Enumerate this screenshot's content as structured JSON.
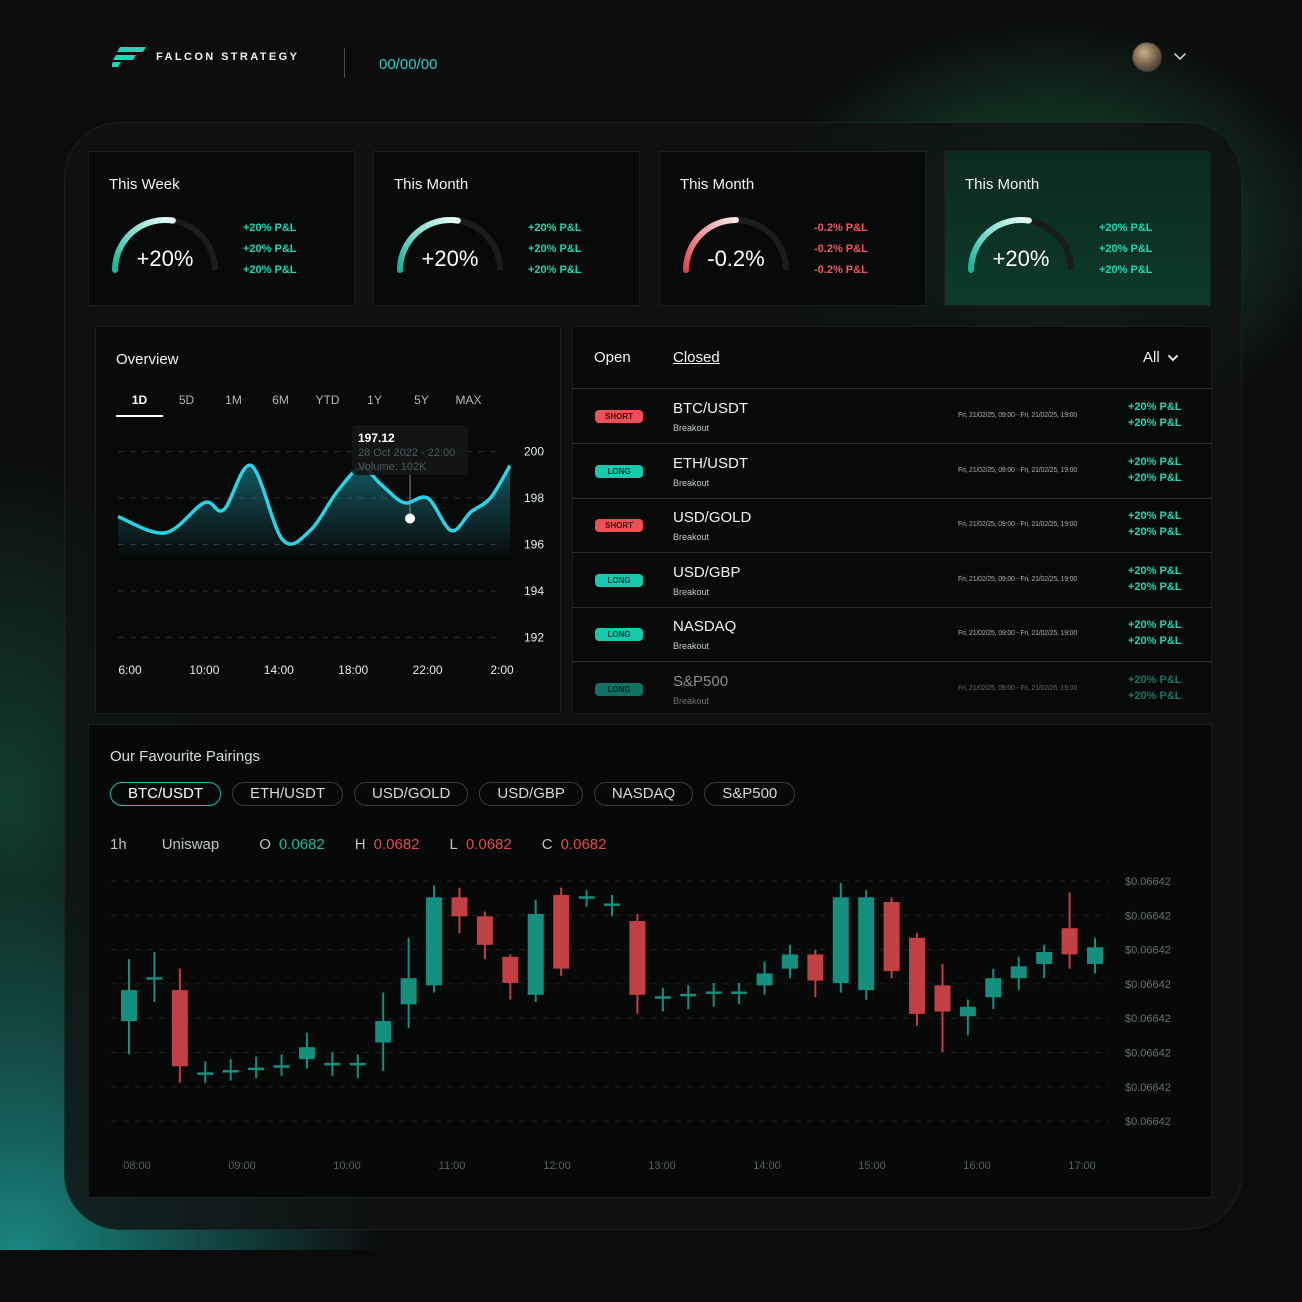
{
  "header": {
    "brand": "FALCON STRATEGY",
    "date": "00/00/00"
  },
  "colors": {
    "accent": "#1fd7b2",
    "negative": "#f0595c",
    "background": "#0c0c0d"
  },
  "stats": [
    {
      "title": "This Week",
      "value": "+20%",
      "gauge": 0.55,
      "tone": "positive",
      "pnl": [
        "+20% P&L",
        "+20% P&L",
        "+20% P&L"
      ]
    },
    {
      "title": "This Month",
      "value": "+20%",
      "gauge": 0.55,
      "tone": "positive",
      "pnl": [
        "+20% P&L",
        "+20% P&L",
        "+20% P&L"
      ]
    },
    {
      "title": "This Month",
      "value": "-0.2%",
      "gauge": 0.5,
      "tone": "negative",
      "pnl": [
        "-0.2% P&L",
        "-0.2% P&L",
        "-0.2% P&L"
      ]
    },
    {
      "title": "This Month",
      "value": "+20%",
      "gauge": 0.55,
      "tone": "positive",
      "pnl": [
        "+20% P&L",
        "+20% P&L",
        "+20% P&L"
      ]
    }
  ],
  "overview": {
    "title": "Overview",
    "ranges": [
      "1D",
      "5D",
      "1M",
      "6M",
      "YTD",
      "1Y",
      "5Y",
      "MAX"
    ],
    "active_range": "1D",
    "tooltip": {
      "value": "197.12",
      "date": "28 Oct 2022 - 22:00",
      "volume": "Volume: 102K"
    }
  },
  "trades": {
    "tabs": {
      "open": "Open",
      "closed": "Closed"
    },
    "filter": "All",
    "rows": [
      {
        "side": "SHORT",
        "pair": "BTC/USDT",
        "strategy": "Breakout",
        "dates": "Fri, 21/02/25, 09:00 - Fri, 21/02/25, 19:00",
        "pnl": [
          "+20% P&L",
          "+20% P&L"
        ]
      },
      {
        "side": "LONG",
        "pair": "ETH/USDT",
        "strategy": "Breakout",
        "dates": "Fri, 21/02/25, 09:00 - Fri, 21/02/25, 19:00",
        "pnl": [
          "+20% P&L",
          "+20% P&L"
        ]
      },
      {
        "side": "SHORT",
        "pair": "USD/GOLD",
        "strategy": "Breakout",
        "dates": "Fri, 21/02/25, 09:00 - Fri, 21/02/25, 19:00",
        "pnl": [
          "+20% P&L",
          "+20% P&L"
        ]
      },
      {
        "side": "LONG",
        "pair": "USD/GBP",
        "strategy": "Breakout",
        "dates": "Fri, 21/02/25, 09:00 - Fri, 21/02/25, 19:00",
        "pnl": [
          "+20% P&L",
          "+20% P&L"
        ]
      },
      {
        "side": "LONG",
        "pair": "NASDAQ",
        "strategy": "Breakout",
        "dates": "Fri, 21/02/25, 09:00 - Fri, 21/02/25, 19:00",
        "pnl": [
          "+20% P&L",
          "+20% P&L"
        ]
      },
      {
        "side": "LONG",
        "pair": "S&P500",
        "strategy": "Breakout",
        "dates": "Fri, 21/02/25, 09:00 - Fri, 21/02/25, 19:00",
        "pnl": [
          "+20% P&L",
          "+20% P&L"
        ]
      }
    ]
  },
  "pairings": {
    "title": "Our Favourite Pairings",
    "chips": [
      "BTC/USDT",
      "ETH/USDT",
      "USD/GOLD",
      "USD/GBP",
      "NASDAQ",
      "S&P500"
    ],
    "active_chip": "BTC/USDT",
    "interval": "1h",
    "exchange": "Uniswap",
    "ohlc": {
      "o_label": "O",
      "o": "0.0682",
      "h_label": "H",
      "h": "0.0682",
      "l_label": "L",
      "l": "0.0682",
      "c_label": "C",
      "c": "0.0682"
    }
  },
  "chart_data": [
    {
      "type": "line",
      "x_ticks": [
        "6:00",
        "10:00",
        "14:00",
        "18:00",
        "22:00",
        "2:00"
      ],
      "y_ticks": [
        200,
        198,
        196,
        194,
        192
      ],
      "ylim": [
        191.5,
        200.5
      ],
      "x_range": [
        0,
        100
      ],
      "points": [
        [
          0,
          197.2
        ],
        [
          12,
          196.5
        ],
        [
          22,
          197.8
        ],
        [
          27,
          197.5
        ],
        [
          34,
          199.4
        ],
        [
          42,
          196.2
        ],
        [
          49,
          196.6
        ],
        [
          56,
          198.3
        ],
        [
          62,
          199.3
        ],
        [
          67,
          198.6
        ],
        [
          73,
          197.8
        ],
        [
          79,
          198.0
        ],
        [
          85,
          196.6
        ],
        [
          90,
          197.4
        ],
        [
          95,
          198.0
        ],
        [
          100,
          199.4
        ]
      ],
      "highlight": {
        "x": 74.5,
        "y": 197.12
      }
    },
    {
      "type": "candlestick",
      "x_ticks": [
        "08:00",
        "09:00",
        "10:00",
        "11:00",
        "12:00",
        "13:00",
        "14:00",
        "15:00",
        "16:00",
        "17:00"
      ],
      "y_ticks": [
        "$0.06642",
        "$0.06642",
        "$0.06642",
        "$0.06642",
        "$0.06642",
        "$0.06642",
        "$0.06642",
        "$0.06642"
      ],
      "ylim": [
        0,
        100
      ],
      "candles": [
        {
          "o": 42,
          "c": 55,
          "h": 68,
          "l": 28
        },
        {
          "o": 60,
          "c": 60,
          "h": 71,
          "l": 50
        },
        {
          "o": 55,
          "c": 23,
          "h": 64,
          "l": 16
        },
        {
          "o": 20,
          "c": 20,
          "h": 25,
          "l": 16
        },
        {
          "o": 21,
          "c": 21,
          "h": 26,
          "l": 17
        },
        {
          "o": 22,
          "c": 22,
          "h": 27,
          "l": 18
        },
        {
          "o": 23,
          "c": 23,
          "h": 28,
          "l": 19
        },
        {
          "o": 26,
          "c": 31,
          "h": 37,
          "l": 22
        },
        {
          "o": 24,
          "c": 24,
          "h": 29,
          "l": 19
        },
        {
          "o": 24,
          "c": 24,
          "h": 28,
          "l": 18
        },
        {
          "o": 33,
          "c": 42,
          "h": 54,
          "l": 21
        },
        {
          "o": 49,
          "c": 60,
          "h": 77,
          "l": 39
        },
        {
          "o": 57,
          "c": 94,
          "h": 99,
          "l": 54
        },
        {
          "o": 94,
          "c": 86,
          "h": 98,
          "l": 79
        },
        {
          "o": 86,
          "c": 74,
          "h": 88,
          "l": 68
        },
        {
          "o": 69,
          "c": 58,
          "h": 70,
          "l": 51
        },
        {
          "o": 53,
          "c": 87,
          "h": 93,
          "l": 50
        },
        {
          "o": 95,
          "c": 64,
          "h": 98,
          "l": 61
        },
        {
          "o": 94,
          "c": 94,
          "h": 97,
          "l": 90
        },
        {
          "o": 91,
          "c": 91,
          "h": 95,
          "l": 86
        },
        {
          "o": 84,
          "c": 53,
          "h": 87,
          "l": 45
        },
        {
          "o": 52,
          "c": 52,
          "h": 56,
          "l": 46
        },
        {
          "o": 53,
          "c": 53,
          "h": 57,
          "l": 47
        },
        {
          "o": 54,
          "c": 54,
          "h": 58,
          "l": 48
        },
        {
          "o": 54,
          "c": 54,
          "h": 58,
          "l": 49
        },
        {
          "o": 57,
          "c": 62,
          "h": 67,
          "l": 53
        },
        {
          "o": 64,
          "c": 70,
          "h": 74,
          "l": 60
        },
        {
          "o": 70,
          "c": 59,
          "h": 72,
          "l": 52
        },
        {
          "o": 58,
          "c": 94,
          "h": 100,
          "l": 54
        },
        {
          "o": 55,
          "c": 94,
          "h": 97,
          "l": 51
        },
        {
          "o": 92,
          "c": 63,
          "h": 94,
          "l": 60
        },
        {
          "o": 77,
          "c": 45,
          "h": 79,
          "l": 40
        },
        {
          "o": 57,
          "c": 46,
          "h": 66,
          "l": 29
        },
        {
          "o": 44,
          "c": 48,
          "h": 51,
          "l": 36
        },
        {
          "o": 52,
          "c": 60,
          "h": 64,
          "l": 47
        },
        {
          "o": 60,
          "c": 65,
          "h": 69,
          "l": 55
        },
        {
          "o": 66,
          "c": 71,
          "h": 74,
          "l": 60
        },
        {
          "o": 81,
          "c": 70,
          "h": 96,
          "l": 64
        },
        {
          "o": 66,
          "c": 73,
          "h": 77,
          "l": 62
        }
      ]
    }
  ]
}
